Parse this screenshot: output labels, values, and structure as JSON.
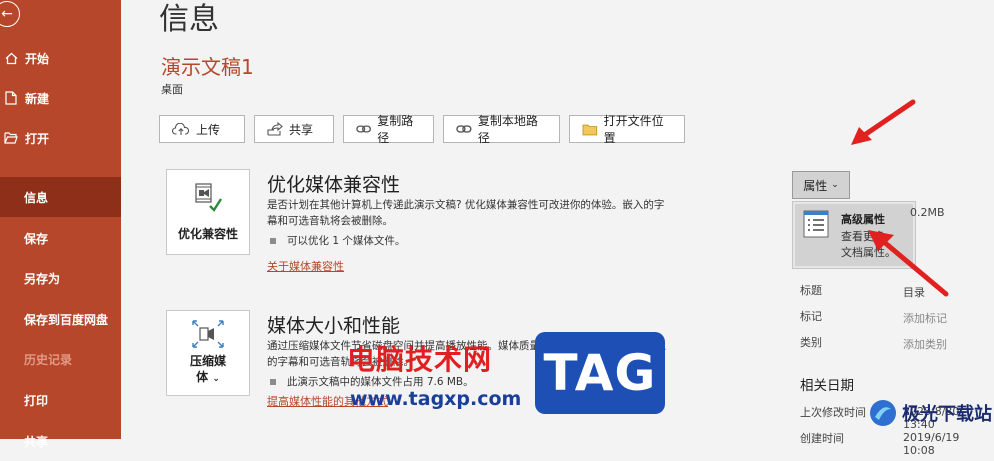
{
  "sidebar": {
    "items": [
      {
        "label": "开始",
        "icon": "home-icon"
      },
      {
        "label": "新建",
        "icon": "new-file-icon"
      },
      {
        "label": "打开",
        "icon": "open-folder-icon"
      },
      {
        "label": "信息",
        "active": true
      },
      {
        "label": "保存"
      },
      {
        "label": "另存为"
      },
      {
        "label": "保存到百度网盘"
      },
      {
        "label": "历史记录",
        "disabled": true
      },
      {
        "label": "打印"
      },
      {
        "label": "共享"
      }
    ]
  },
  "header": {
    "title": "信息",
    "doc_name": "演示文稿1",
    "doc_location": "桌面"
  },
  "toolbar": {
    "upload": "上传",
    "share": "共享",
    "copy_path": "复制路径",
    "copy_local_path": "复制本地路径",
    "open_location": "打开文件位置"
  },
  "optimize": {
    "tile_label": "优化兼容性",
    "title": "优化媒体兼容性",
    "desc_line1": "是否计划在其他计算机上传递此演示文稿? 优化媒体兼容性可改进你的体验。嵌入的字",
    "desc_line2": "幕和可选音轨将会被删除。",
    "bullet": "可以优化 1 个媒体文件。",
    "link": "关于媒体兼容性"
  },
  "compress": {
    "tile_line1": "压缩媒",
    "tile_line2": "体",
    "title": "媒体大小和性能",
    "desc_line1": "通过压缩媒体文件节省磁盘空间并提高播放性能。媒体质量可能会受压缩的影响。嵌入",
    "desc_line2": "的字幕和可选音轨将会被删除。",
    "bullet": "此演示文稿中的媒体文件占用 7.6 MB。",
    "link": "提高媒体性能的其他方式"
  },
  "properties": {
    "button_label": "属性",
    "menu_title": "高级属性",
    "menu_desc_line1": "查看更多",
    "menu_desc_line2": "文档属性。",
    "size_value": "0.2MB",
    "rows": [
      {
        "label": "标题",
        "value": "目录",
        "placeholder": false
      },
      {
        "label": "标记",
        "value": "添加标记",
        "placeholder": true
      },
      {
        "label": "类别",
        "value": "添加类别",
        "placeholder": true
      }
    ],
    "dates_heading": "相关日期",
    "dates": [
      {
        "label": "上次修改时间",
        "value": "2023/8/30 13:40"
      },
      {
        "label": "创建时间",
        "value": "2019/6/19 10:08"
      }
    ]
  },
  "watermark": {
    "cn_text": "电脑技术网",
    "url": "www.tagxp.com",
    "tag": "TAG",
    "corner_text": "极光下载站"
  },
  "colors": {
    "accent": "#b7472a",
    "active_nav": "#8e2f19",
    "arrow": "#e0211f"
  }
}
